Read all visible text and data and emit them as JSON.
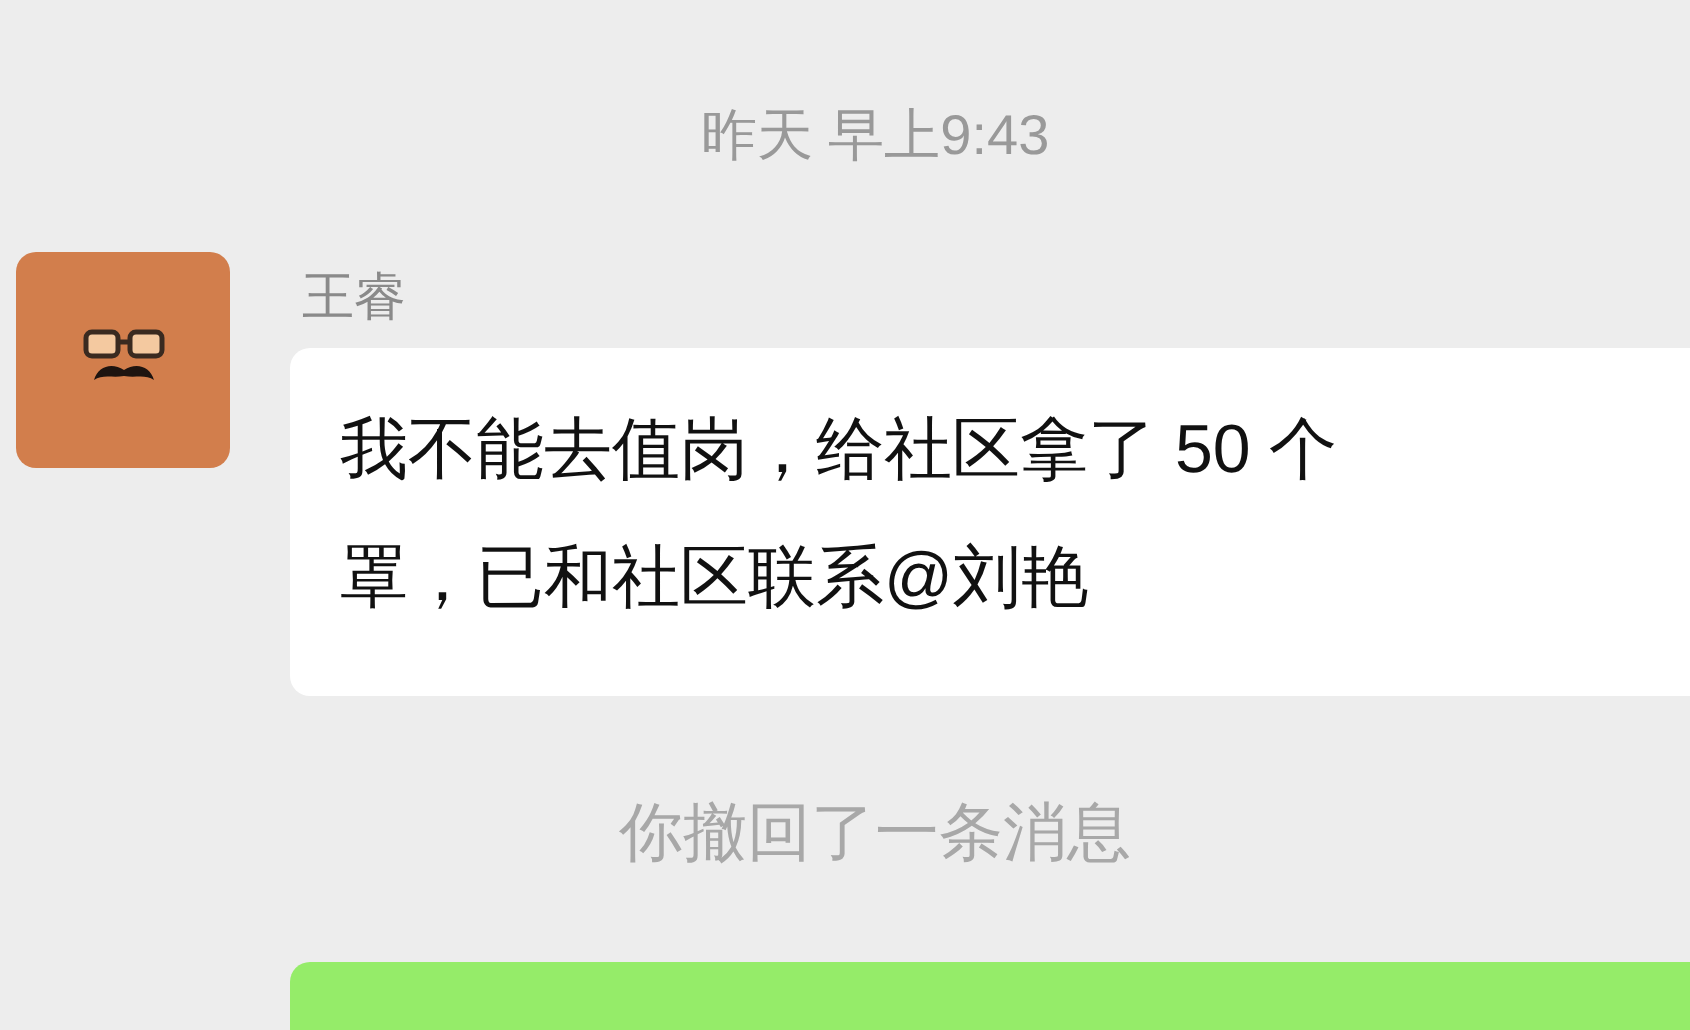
{
  "timestamp": "昨天 早上9:43",
  "messages": [
    {
      "kind": "incoming",
      "sender": "王睿",
      "lines": [
        "我不能去值岗，给社区拿了 50 个",
        "罩，已和社区联系@刘艳"
      ]
    },
    {
      "kind": "notice",
      "text": "你撤回了一条消息"
    },
    {
      "kind": "outgoing"
    }
  ]
}
